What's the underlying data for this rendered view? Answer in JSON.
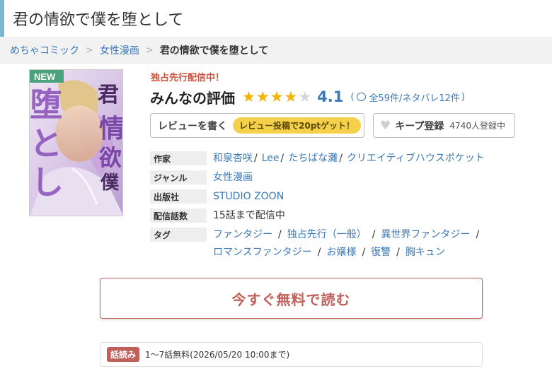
{
  "page_title": "君の情欲で僕を堕として",
  "breadcrumb": {
    "items": [
      "めちゃコミック",
      "女性漫画"
    ],
    "current": "君の情欲で僕を堕として",
    "separator": ">"
  },
  "cover": {
    "badge": "NEW",
    "title_text": "君の情欲で僕を堕として"
  },
  "exclusive_notice": "独占先行配信中！",
  "rating": {
    "label": "みんなの評価",
    "score": "4.1",
    "stars_filled": 4,
    "stars_total": 5,
    "open_paren": "(",
    "reviews_text": "全59件/ネタバレ12件",
    "close_paren": ")"
  },
  "review_button": {
    "label": "レビューを書く",
    "bonus": "レビュー投稿で20ptゲット！"
  },
  "keep_button": {
    "label": "キープ登録",
    "count": "4740人登録中"
  },
  "info": {
    "author_label": "作家",
    "authors": [
      "和泉杏咲",
      "Lee",
      "たちばな灘",
      "クリエイティブハウスポケット"
    ],
    "author_sep": "/",
    "genre_label": "ジャンル",
    "genre": "女性漫画",
    "publisher_label": "出版社",
    "publisher": "STUDIO ZOON",
    "episodes_label": "配信話数",
    "episodes": "15話まで配信中",
    "tags_label": "タグ",
    "tags": [
      "ファンタジー",
      "独占先行（一般）",
      "異世界ファンタジー",
      "ロマンスファンタジー",
      "お嬢様",
      "復讐",
      "胸キュン"
    ],
    "tag_sep": "/"
  },
  "read_button": {
    "label": "今すぐ無料で読む"
  },
  "free_campaign": {
    "badge": "話読み",
    "text": "1〜7話無料(2026/05/20 10:00まで)"
  },
  "colors": {
    "accent_blue": "#3b78b5",
    "accent_red": "#c0605a",
    "star_gold": "#f2b400",
    "title_border": "#7cb6d6"
  }
}
